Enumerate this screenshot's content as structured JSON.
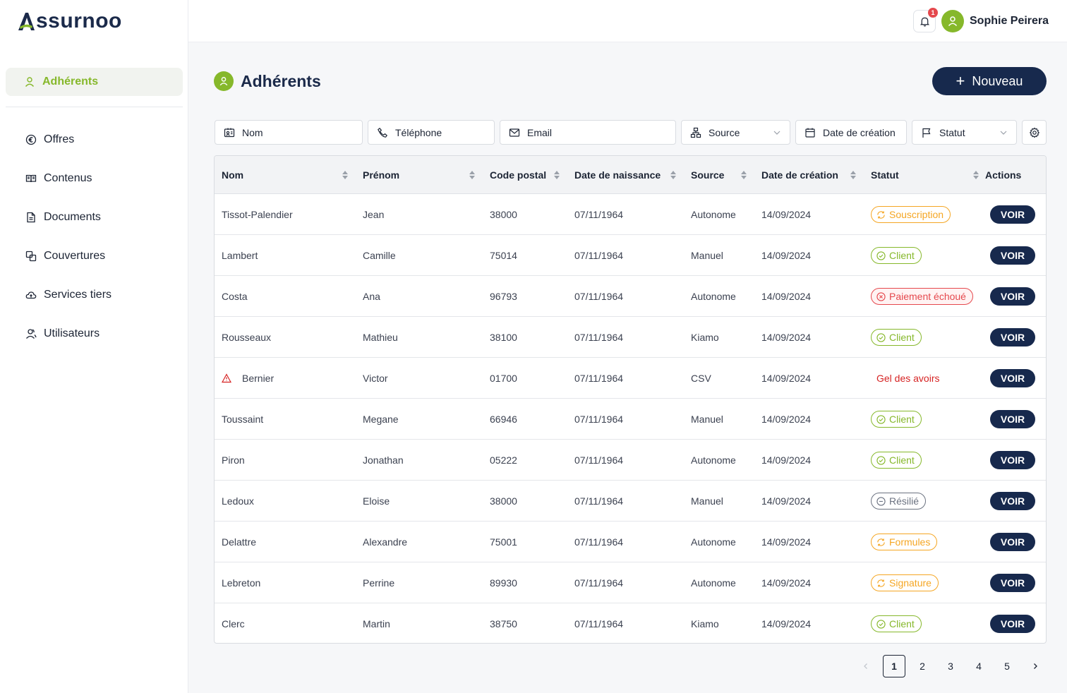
{
  "brand": {
    "name": "ssurnoo",
    "accent": "#86b82b",
    "navy": "#17294d"
  },
  "sidebar": {
    "active": {
      "label": "Adhérents",
      "icon": "user-icon"
    },
    "items": [
      {
        "label": "Offres",
        "icon": "euro-icon"
      },
      {
        "label": "Contenus",
        "icon": "book-icon"
      },
      {
        "label": "Documents",
        "icon": "document-icon"
      },
      {
        "label": "Couvertures",
        "icon": "layers-icon"
      },
      {
        "label": "Services tiers",
        "icon": "cloud-icon"
      },
      {
        "label": "Utilisateurs",
        "icon": "users-icon"
      }
    ]
  },
  "topbar": {
    "notifications_count": "1",
    "user_name": "Sophie Peirera"
  },
  "page": {
    "title": "Adhérents",
    "new_button": "Nouveau"
  },
  "filters": {
    "nom": "Nom",
    "telephone": "Téléphone",
    "email": "Email",
    "source": "Source",
    "date_creation": "Date de création",
    "statut": "Statut"
  },
  "table": {
    "headers": [
      "Nom",
      "Prénom",
      "Code postal",
      "Date de naissance",
      "Source",
      "Date de création",
      "Statut",
      "Actions"
    ],
    "action_label": "VOIR",
    "rows": [
      {
        "nom": "Tissot-Palendier",
        "prenom": "Jean",
        "cp": "38000",
        "naissance": "07/11/1964",
        "source": "Autonome",
        "creation": "14/09/2024",
        "statut": "Souscription",
        "type": "orange",
        "alert": false
      },
      {
        "nom": "Lambert",
        "prenom": "Camille",
        "cp": "75014",
        "naissance": "07/11/1964",
        "source": "Manuel",
        "creation": "14/09/2024",
        "statut": "Client",
        "type": "green",
        "alert": false
      },
      {
        "nom": "Costa",
        "prenom": "Ana",
        "cp": "96793",
        "naissance": "07/11/1964",
        "source": "Autonome",
        "creation": "14/09/2024",
        "statut": "Paiement échoué",
        "type": "red",
        "alert": false
      },
      {
        "nom": "Rousseaux",
        "prenom": "Mathieu",
        "cp": "38100",
        "naissance": "07/11/1964",
        "source": "Kiamo",
        "creation": "14/09/2024",
        "statut": "Client",
        "type": "green",
        "alert": false
      },
      {
        "nom": "Bernier",
        "prenom": "Victor",
        "cp": "01700",
        "naissance": "07/11/1964",
        "source": "CSV",
        "creation": "14/09/2024",
        "statut": "Gel des avoirs",
        "type": "plain",
        "alert": true
      },
      {
        "nom": "Toussaint",
        "prenom": "Megane",
        "cp": "66946",
        "naissance": "07/11/1964",
        "source": "Manuel",
        "creation": "14/09/2024",
        "statut": "Client",
        "type": "green",
        "alert": false
      },
      {
        "nom": "Piron",
        "prenom": "Jonathan",
        "cp": "05222",
        "naissance": "07/11/1964",
        "source": "Autonome",
        "creation": "14/09/2024",
        "statut": "Client",
        "type": "green",
        "alert": false
      },
      {
        "nom": "Ledoux",
        "prenom": "Eloise",
        "cp": "38000",
        "naissance": "07/11/1964",
        "source": "Manuel",
        "creation": "14/09/2024",
        "statut": "Résilié",
        "type": "grey",
        "alert": false
      },
      {
        "nom": "Delattre",
        "prenom": "Alexandre",
        "cp": "75001",
        "naissance": "07/11/1964",
        "source": "Autonome",
        "creation": "14/09/2024",
        "statut": "Formules",
        "type": "orange",
        "alert": false
      },
      {
        "nom": "Lebreton",
        "prenom": "Perrine",
        "cp": "89930",
        "naissance": "07/11/1964",
        "source": "Autonome",
        "creation": "14/09/2024",
        "statut": "Signature",
        "type": "orange",
        "alert": false
      },
      {
        "nom": "Clerc",
        "prenom": "Martin",
        "cp": "38750",
        "naissance": "07/11/1964",
        "source": "Kiamo",
        "creation": "14/09/2024",
        "statut": "Client",
        "type": "green",
        "alert": false
      }
    ]
  },
  "pagination": {
    "pages": [
      "1",
      "2",
      "3",
      "4",
      "5"
    ],
    "current": "1"
  }
}
